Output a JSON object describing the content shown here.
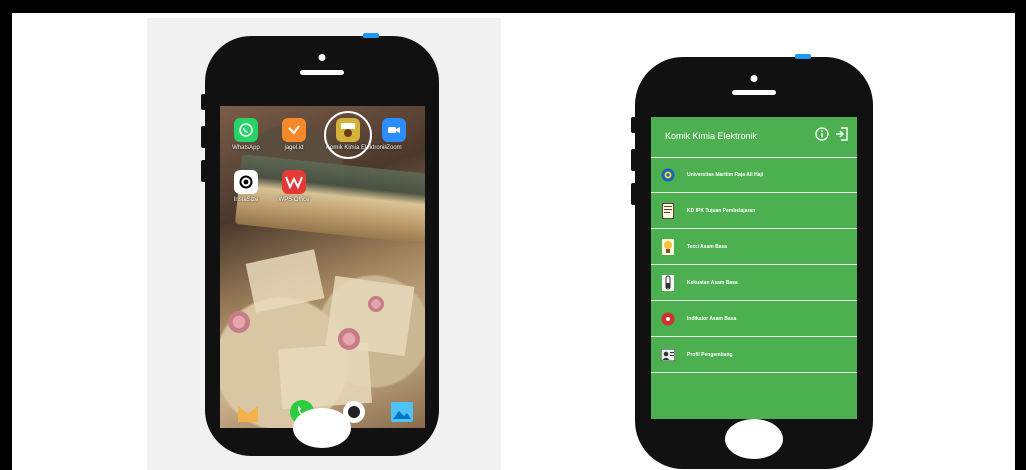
{
  "left_phone": {
    "apps": [
      {
        "label": "WhatsApp",
        "icon": "whatsapp-icon",
        "color": "#25d366"
      },
      {
        "label": "jagel.id",
        "icon": "jagel-icon",
        "color": "#f5882a"
      },
      {
        "label": "Komik Kimia Elektronik",
        "icon": "komik-kimia-icon",
        "color": "#d4b23a"
      },
      {
        "label": "Zoom",
        "icon": "zoom-icon",
        "color": "#2d8cff"
      },
      {
        "label": "InstaSize",
        "icon": "instasize-icon",
        "color": "#ffffff"
      },
      {
        "label": "WPS Office",
        "icon": "wps-office-icon",
        "color": "#e53935"
      }
    ],
    "dock": [
      {
        "icon": "notes-icon",
        "color": "#f6b24a"
      },
      {
        "icon": "phone-call-icon",
        "color": "#2ecc40"
      },
      {
        "icon": "camera-icon",
        "color": "#ffffff"
      },
      {
        "icon": "gallery-icon",
        "color": "#4fc3f7"
      }
    ]
  },
  "right_phone": {
    "app_title": "Komik Kimia Elektronik",
    "header_icons": [
      "info-icon",
      "exit-icon"
    ],
    "menu": [
      {
        "label": "Universitas Maritim Raja Ali Haji",
        "icon": "university-logo-icon"
      },
      {
        "label": "KD IPK Tujuan Pembelajaran",
        "icon": "document-icon"
      },
      {
        "label": "Teori Asam Basa",
        "icon": "lightbulb-icon"
      },
      {
        "label": "Kekuatan Asam Basa",
        "icon": "test-tube-icon"
      },
      {
        "label": "Indikator Asam Basa",
        "icon": "indicator-icon"
      },
      {
        "label": "Profil Pengembang",
        "icon": "profile-icon"
      }
    ]
  },
  "colors": {
    "app_green": "#4caf50",
    "phone_body": "#111111",
    "top_button": "#2196f3"
  }
}
